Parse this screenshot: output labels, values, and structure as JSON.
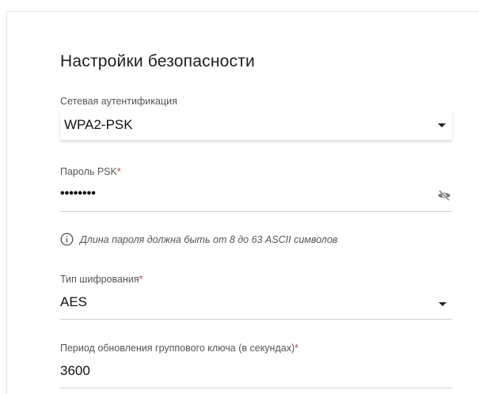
{
  "section": {
    "title": "Настройки безопасности"
  },
  "auth": {
    "label": "Сетевая аутентификация",
    "value": "WPA2-PSK"
  },
  "psk": {
    "label": "Пароль PSK",
    "required_mark": "*",
    "value": "••••••••"
  },
  "hint": {
    "text": "Длина пароля должна быть от 8 до 63 ASCII символов"
  },
  "encryption": {
    "label": "Тип шифрования",
    "required_mark": "*",
    "value": "AES"
  },
  "rekey": {
    "label": "Период обновления группового ключа (в секундах)",
    "required_mark": "*",
    "value": "3600"
  },
  "colors": {
    "required": "#e53935",
    "text": "#202020",
    "muted": "#555555"
  }
}
